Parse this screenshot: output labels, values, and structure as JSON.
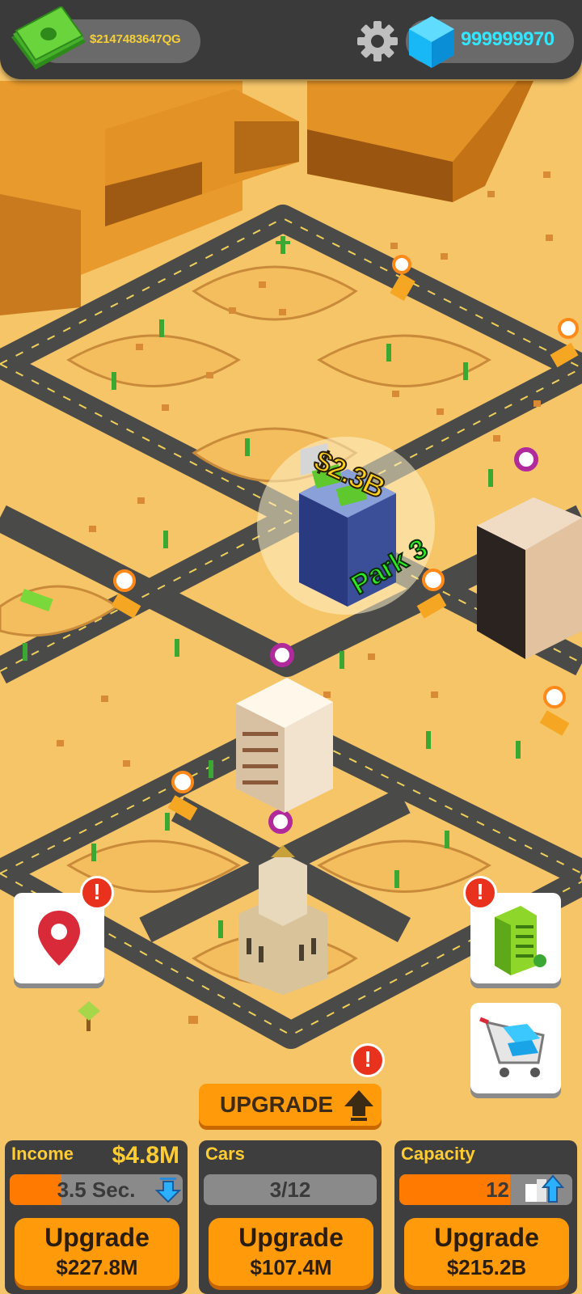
{
  "header": {
    "money": "$2147483647QG",
    "gems": "999999970",
    "icons": {
      "money": "cash-stack-icon",
      "settings": "gear-icon",
      "gems": "blue-gem-icon"
    }
  },
  "world": {
    "floating_income": "$2.3B",
    "park_label": "Park 3"
  },
  "side_buttons": {
    "map_icon": "map-pin-icon",
    "buildings_icon": "building-icon",
    "shop_icon": "shopping-cart-icon",
    "alert": "!"
  },
  "upgrade_main": {
    "label": "UPGRADE",
    "alert": "!"
  },
  "panels": {
    "income": {
      "title": "Income",
      "value": "$4.8M",
      "bar_text": "3.5 Sec.",
      "bar_fill": 0.3,
      "button": "Upgrade",
      "cost": "$227.8M"
    },
    "cars": {
      "title": "Cars",
      "bar_text": "3/12",
      "button": "Upgrade",
      "cost": "$107.4M"
    },
    "capacity": {
      "title": "Capacity",
      "bar_text": "12",
      "bar_fill": 0.64,
      "button": "Upgrade",
      "cost": "$215.2B"
    }
  },
  "colors": {
    "sand": "#f5c568",
    "road": "#4a4a48",
    "accent": "#ff9a0a",
    "gold": "#ffcc33",
    "gem": "#33e6ff"
  }
}
